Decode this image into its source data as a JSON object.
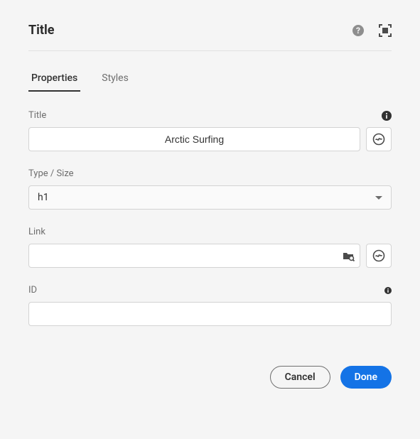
{
  "header": {
    "title": "Title"
  },
  "tabs": [
    {
      "label": "Properties",
      "active": true
    },
    {
      "label": "Styles",
      "active": false
    }
  ],
  "fields": {
    "title": {
      "label": "Title",
      "value": "Arctic Surfing"
    },
    "typeSize": {
      "label": "Type / Size",
      "value": "h1"
    },
    "link": {
      "label": "Link",
      "value": ""
    },
    "id": {
      "label": "ID",
      "value": ""
    }
  },
  "footer": {
    "cancel": "Cancel",
    "done": "Done"
  }
}
